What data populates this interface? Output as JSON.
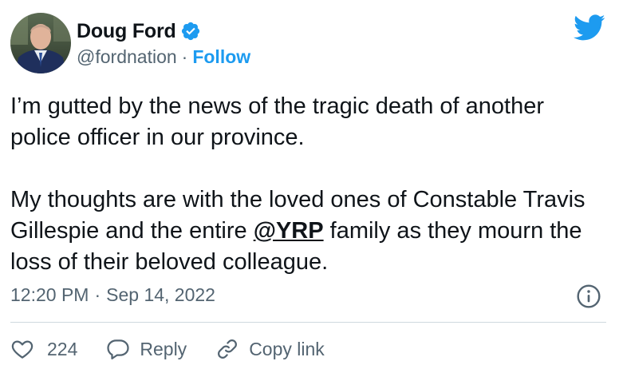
{
  "author": {
    "name": "Doug Ford",
    "handle": "@fordnation",
    "separator": "·",
    "follow_label": "Follow",
    "verified": true
  },
  "tweet": {
    "paragraph1": "I’m gutted by the news of the tragic death of another police officer in our province.",
    "paragraph2_before": "My thoughts are with the loved ones of Constable Travis Gillespie and the entire ",
    "mention": "@YRP",
    "paragraph2_after": " family as they mourn the loss of their beloved colleague."
  },
  "meta": {
    "time": "12:20 PM",
    "separator": "·",
    "date": "Sep 14, 2022"
  },
  "actions": {
    "like_count": "224",
    "reply_label": "Reply",
    "copy_link_label": "Copy link"
  },
  "icons": {
    "twitter": "twitter-bird-icon",
    "verified": "verified-badge-icon",
    "info": "info-icon",
    "like": "heart-icon",
    "reply": "reply-bubble-icon",
    "copy_link": "link-icon"
  },
  "colors": {
    "accent": "#1d9bf0",
    "text": "#0f1419",
    "secondary": "#536471",
    "divider": "#cfd9de"
  }
}
